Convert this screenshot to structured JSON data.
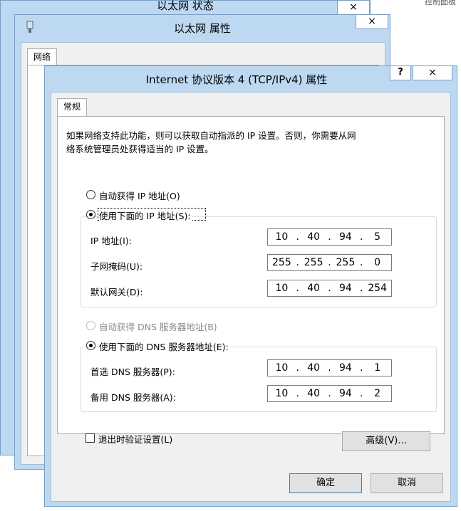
{
  "background_window": {
    "title": "以太网 状态",
    "close": "×",
    "right_text": "控制面板"
  },
  "props_window": {
    "title": "以太网 属性",
    "close": "×",
    "tab": "网络"
  },
  "ipv4_dialog": {
    "title": "Internet 协议版本 4 (TCP/IPv4) 属性",
    "help": "?",
    "close": "×",
    "tab": "常规",
    "description_line1": "如果网络支持此功能，则可以获取自动指派的 IP 设置。否则，你需要从网",
    "description_line2": "络系统管理员处获得适当的 IP 设置。",
    "auto_ip_label": "自动获得 IP 地址(O)",
    "manual_ip_label": "使用下面的 IP 地址(S):",
    "ip_address_label": "IP 地址(I):",
    "ip_address": [
      "10",
      "40",
      "94",
      "5"
    ],
    "subnet_label": "子网掩码(U):",
    "subnet_mask": [
      "255",
      "255",
      "255",
      "0"
    ],
    "gateway_label": "默认网关(D):",
    "gateway": [
      "10",
      "40",
      "94",
      "254"
    ],
    "auto_dns_label": "自动获得 DNS 服务器地址(B)",
    "manual_dns_label": "使用下面的 DNS 服务器地址(E):",
    "preferred_dns_label": "首选 DNS 服务器(P):",
    "preferred_dns": [
      "10",
      "40",
      "94",
      "1"
    ],
    "alternate_dns_label": "备用 DNS 服务器(A):",
    "alternate_dns": [
      "10",
      "40",
      "94",
      "2"
    ],
    "validate_label": "退出时验证设置(L)",
    "advanced_button": "高级(V)...",
    "ok_button": "确定",
    "cancel_button": "取消"
  },
  "colors": {
    "frame": "#bcd9f1",
    "dialog_bg": "#f0f0f0"
  }
}
